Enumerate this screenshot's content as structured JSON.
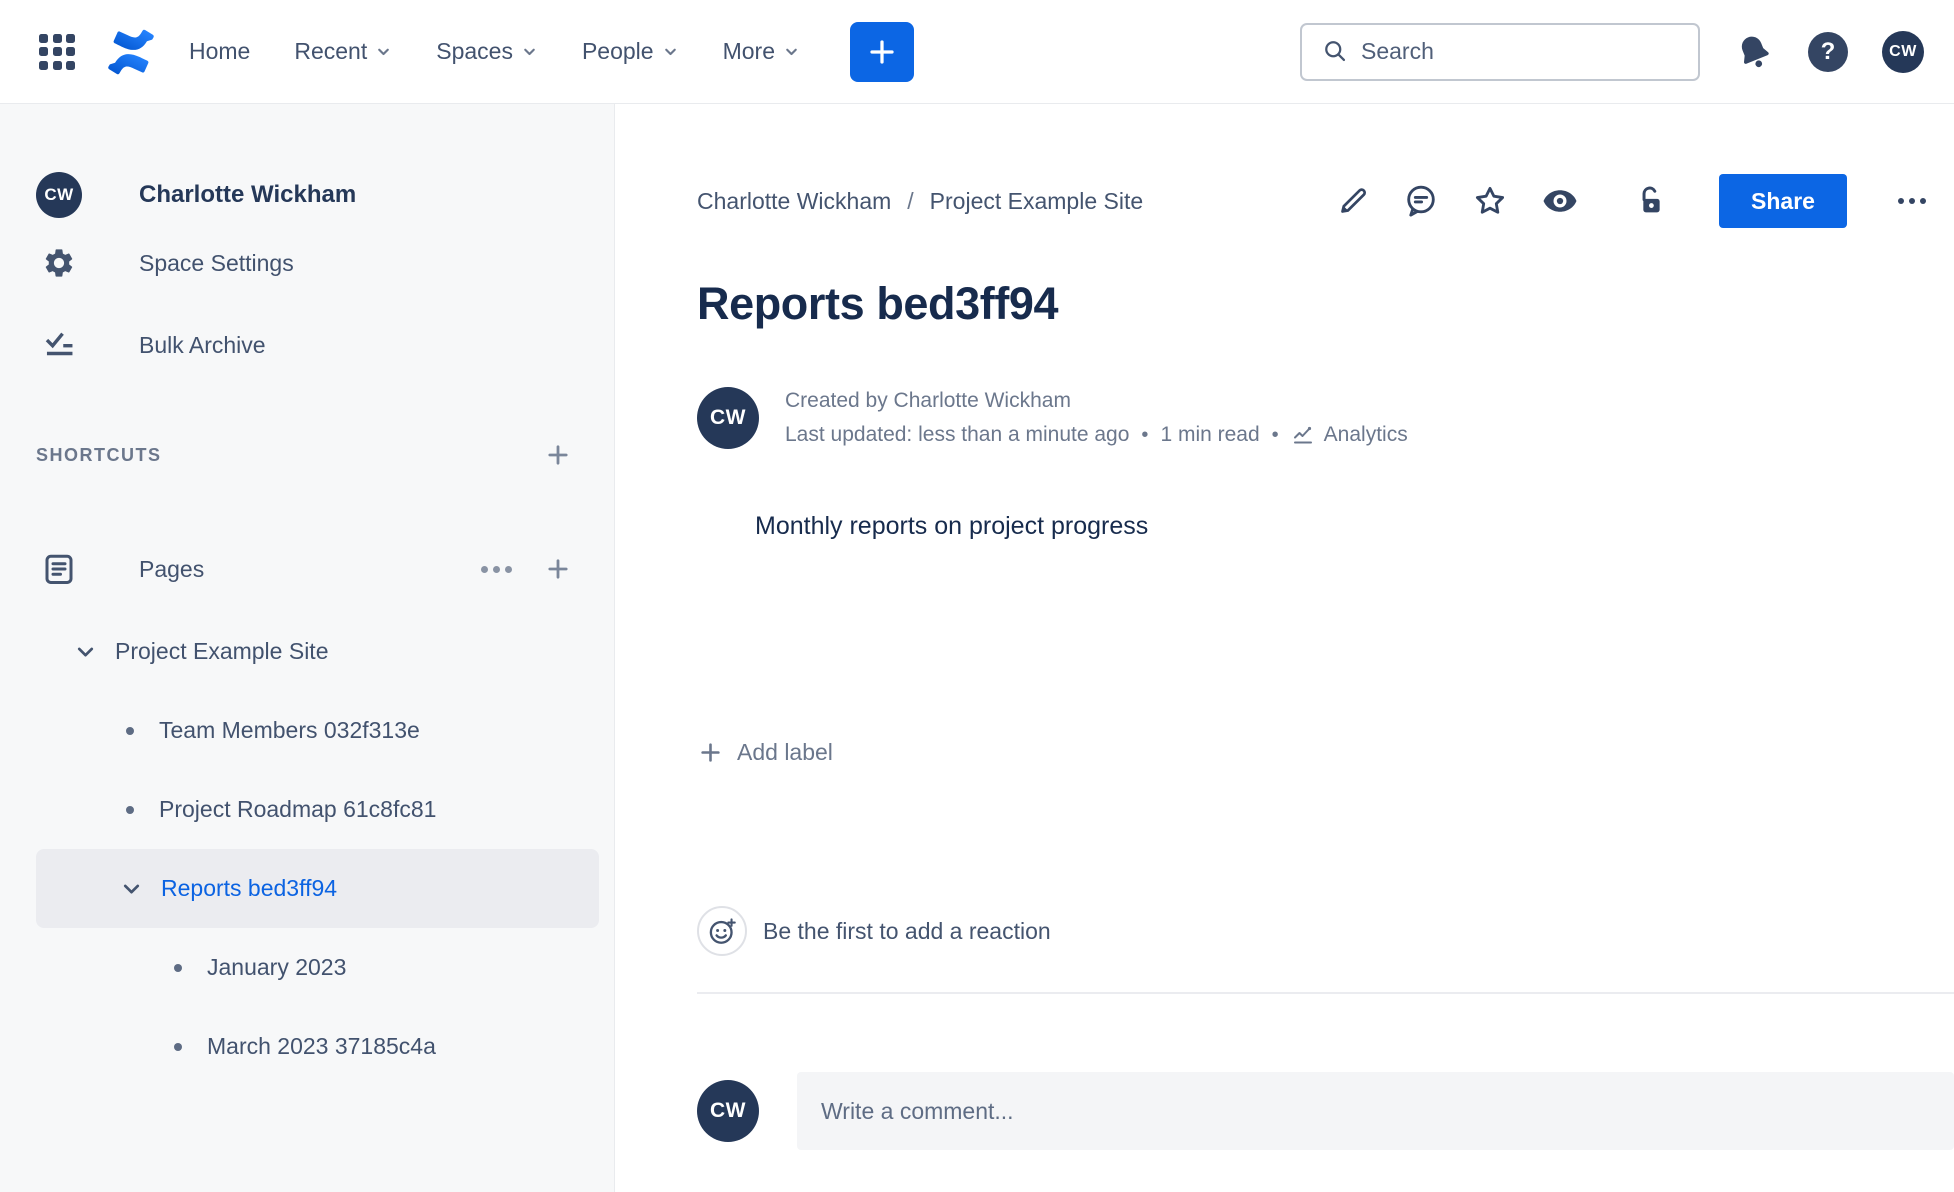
{
  "topnav": {
    "menu": [
      {
        "label": "Home"
      },
      {
        "label": "Recent"
      },
      {
        "label": "Spaces"
      },
      {
        "label": "People"
      },
      {
        "label": "More"
      }
    ],
    "search_placeholder": "Search",
    "avatar_initials": "CW"
  },
  "sidebar": {
    "space_name": "Charlotte Wickham",
    "space_avatar_initials": "CW",
    "items": [
      {
        "label": "Space Settings"
      },
      {
        "label": "Bulk Archive"
      }
    ],
    "shortcuts_heading": "SHORTCUTS",
    "pages_label": "Pages",
    "tree": [
      {
        "label": "Project Example Site"
      },
      {
        "label": "Team Members 032f313e"
      },
      {
        "label": "Project Roadmap 61c8fc81"
      },
      {
        "label": "Reports bed3ff94"
      },
      {
        "label": "January 2023"
      },
      {
        "label": "March 2023 37185c4a"
      }
    ]
  },
  "content": {
    "breadcrumb": [
      "Charlotte Wickham",
      "Project Example Site"
    ],
    "share_label": "Share",
    "title": "Reports bed3ff94",
    "byline": {
      "created": "Created by Charlotte Wickham",
      "last_updated": "Last updated: less than a minute ago",
      "read_time": "1 min read",
      "analytics_label": "Analytics",
      "avatar_initials": "CW"
    },
    "body_text": "Monthly reports on project progress",
    "add_label_text": "Add label",
    "reaction_prompt": "Be the first to add a reaction",
    "comment": {
      "placeholder": "Write a comment...",
      "avatar_initials": "CW"
    }
  },
  "icons": {
    "question": "?",
    "dot": "•"
  },
  "colors": {
    "accent_blue": "#0C66E4",
    "navy_icon": "#344563",
    "heading": "#172B4D",
    "muted": "#6B778C",
    "sidebar_bg": "#F7F8F9",
    "selected_bg": "#EBECF0"
  }
}
